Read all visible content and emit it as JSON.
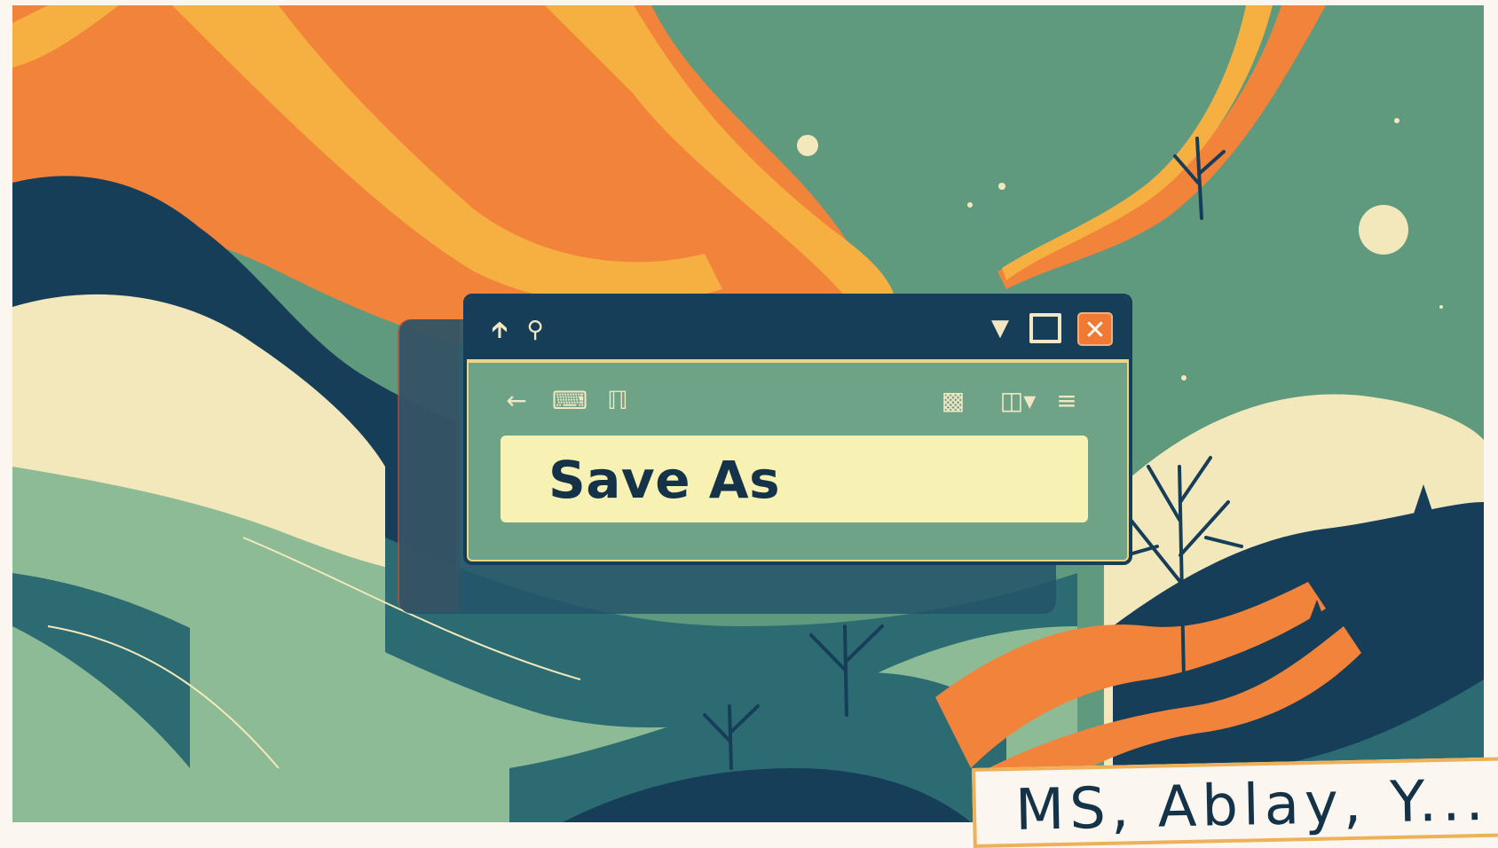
{
  "dialog": {
    "titlebar": {
      "icons": [
        "upload-arrow-icon",
        "search-person-icon"
      ],
      "controls": {
        "minimize": "chevron-down-icon",
        "maximize": "maximize-icon",
        "close": "close-icon"
      }
    },
    "toolbar": {
      "icons": [
        "back-arrow-icon",
        "folder-icon",
        "branch-icon",
        "view-icon",
        "new-icon",
        "menu-icon"
      ]
    },
    "field": {
      "value": "Save As"
    }
  },
  "watermark": {
    "text": "MS, Ablay, Y..."
  },
  "colors": {
    "teal_sky": "#5f9a7f",
    "orange": "#f2833a",
    "gold": "#f6b041",
    "navy": "#173e58",
    "cream": "#f3e8bb",
    "field_bg": "#f7f1b3",
    "close_button": "#f07a34"
  }
}
